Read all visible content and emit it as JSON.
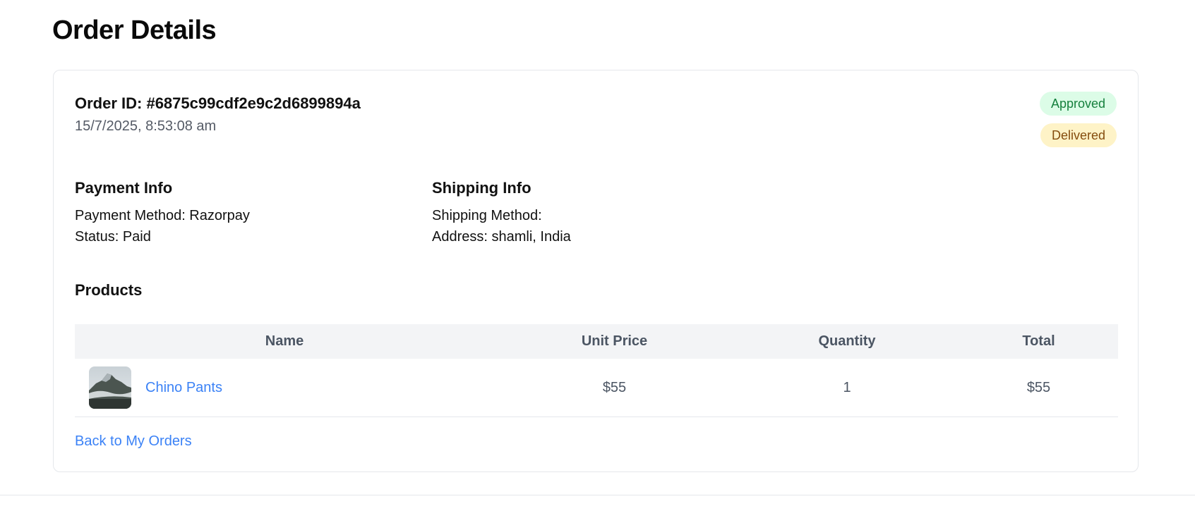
{
  "page": {
    "title": "Order Details"
  },
  "order": {
    "id_text": "Order ID: #6875c99cdf2e9c2d6899894a",
    "date": "15/7/2025, 8:53:08 am",
    "badges": {
      "approved": "Approved",
      "delivered": "Delivered"
    }
  },
  "payment": {
    "heading": "Payment Info",
    "method": "Payment Method: Razorpay",
    "status": "Status: Paid"
  },
  "shipping": {
    "heading": "Shipping Info",
    "method": "Shipping Method:",
    "address": "Address: shamli, India"
  },
  "products": {
    "heading": "Products",
    "columns": [
      "Name",
      "Unit Price",
      "Quantity",
      "Total"
    ],
    "rows": [
      {
        "image_icon": "mountain-photo",
        "name": "Chino Pants",
        "unit_price": "$55",
        "quantity": "1",
        "total": "$55"
      }
    ]
  },
  "links": {
    "back": "Back to My Orders"
  },
  "colors": {
    "link": "#3b82f6",
    "approved_bg": "#dcfce7",
    "approved_text": "#15803d",
    "delivered_bg": "#fef3c7",
    "delivered_text": "#854d0e",
    "table_header_bg": "#f3f4f6"
  }
}
